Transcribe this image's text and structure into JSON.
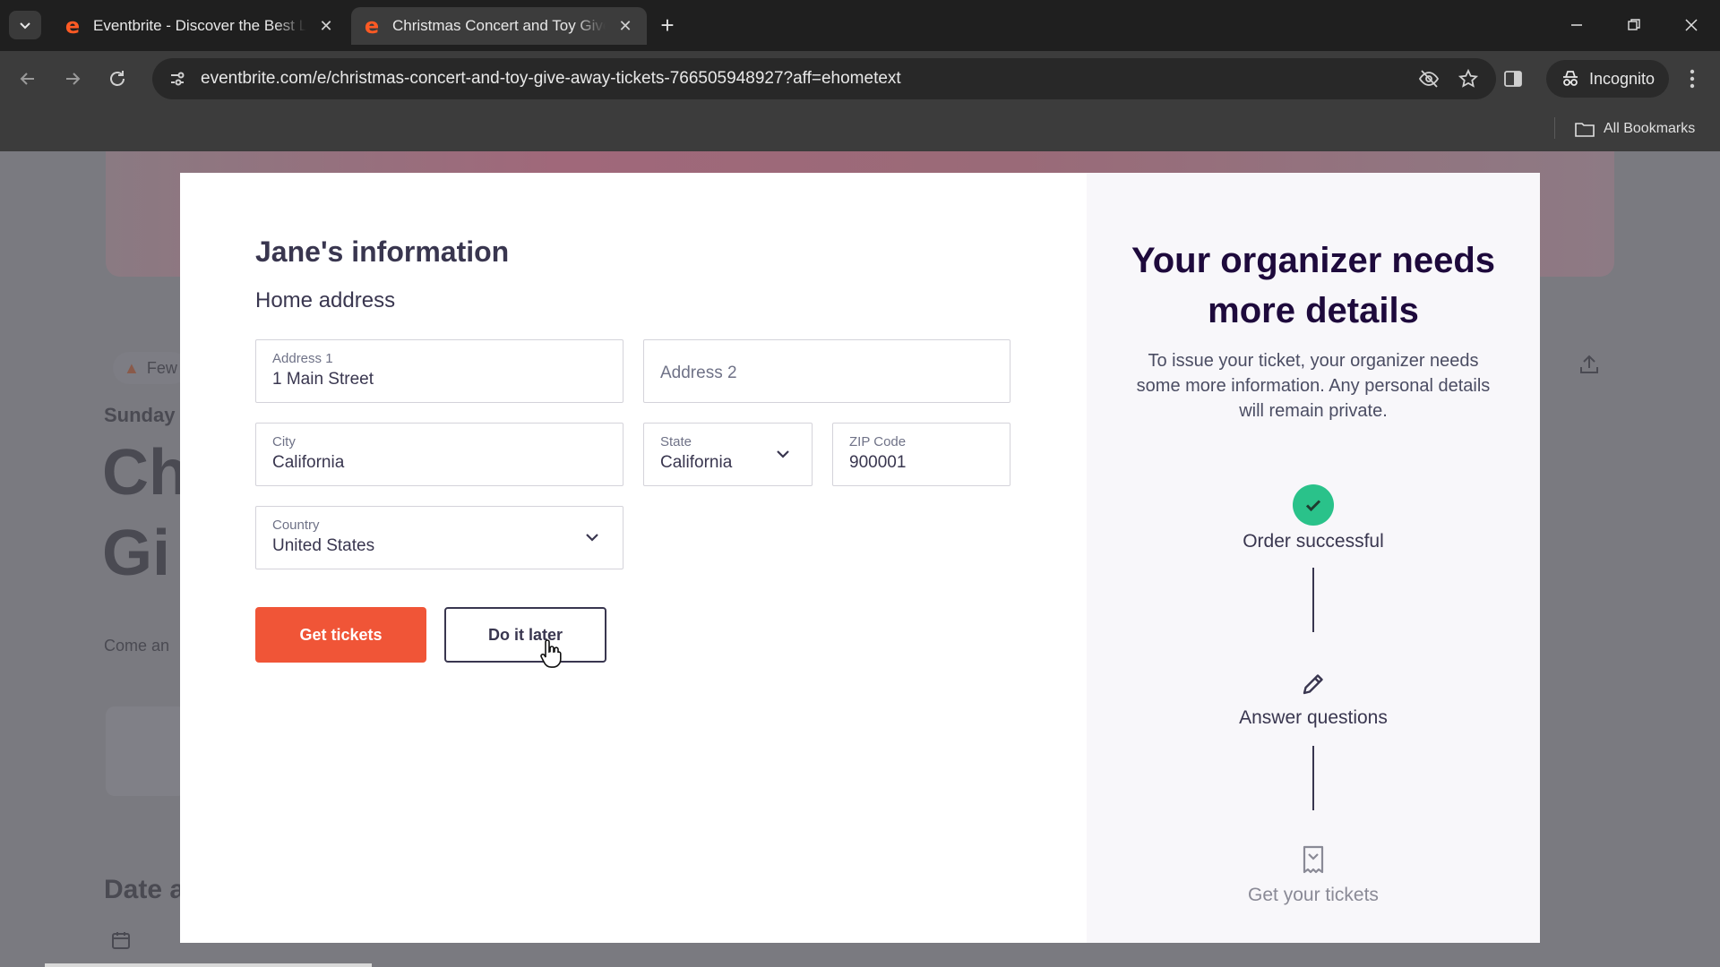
{
  "browser": {
    "tabs": [
      {
        "title": "Eventbrite - Discover the Best L",
        "favicon": "e",
        "active": false
      },
      {
        "title": "Christmas Concert and Toy Give",
        "favicon": "e",
        "active": true
      }
    ],
    "url": "eventbrite.com/e/christmas-concert-and-toy-give-away-tickets-766505948927?aff=ehometext",
    "incognito_label": "Incognito",
    "bookmarks_label": "All Bookmarks"
  },
  "background_page": {
    "badge": "Few",
    "date_prefix": "Sunday",
    "title_line1": "Ch",
    "title_line2": "Gi",
    "description_prefix": "Come an",
    "date_section": "Date a"
  },
  "form": {
    "heading": "Jane's information",
    "subheading": "Home address",
    "address1": {
      "label": "Address 1",
      "value": "1 Main Street"
    },
    "address2": {
      "placeholder": "Address 2"
    },
    "city": {
      "label": "City",
      "value": "California"
    },
    "state": {
      "label": "State",
      "value": "California"
    },
    "zip": {
      "label": "ZIP Code",
      "value": "900001"
    },
    "country": {
      "label": "Country",
      "value": "United States"
    },
    "primary_button": "Get tickets",
    "secondary_button": "Do it later"
  },
  "side_panel": {
    "title": "Your organizer needs more details",
    "description": "To issue your ticket, your organizer needs some more information. Any personal details will remain private.",
    "steps": [
      {
        "label": "Order successful",
        "state": "done"
      },
      {
        "label": "Answer questions",
        "state": "current"
      },
      {
        "label": "Get your tickets",
        "state": "pending"
      }
    ]
  },
  "colors": {
    "accent": "#f05537",
    "success": "#2ac28a",
    "text_dark": "#39364f",
    "text_muted": "#6f7287"
  }
}
